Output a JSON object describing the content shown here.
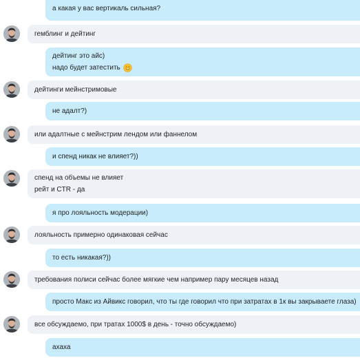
{
  "messages": [
    {
      "dir": "out",
      "lines": [
        "а какая у вас вертикаль сильная?"
      ]
    },
    {
      "dir": "in",
      "lines": [
        "гемблинг и дейтинг"
      ]
    },
    {
      "dir": "out",
      "lines": [
        "дейтинг это айс)",
        "надо будет затестить"
      ],
      "emoji": "smile-emoji"
    },
    {
      "dir": "in",
      "lines": [
        "дейтинги мейнстримовые"
      ]
    },
    {
      "dir": "out",
      "lines": [
        "не адалт?)"
      ]
    },
    {
      "dir": "in",
      "lines": [
        "или адалтные с мейнстрим лендом или фаннелом"
      ]
    },
    {
      "dir": "out",
      "lines": [
        "и спенд никак не влияет?))"
      ]
    },
    {
      "dir": "in",
      "lines": [
        "спенд на объемы не влияет",
        "рейт и CTR - да"
      ]
    },
    {
      "dir": "out",
      "lines": [
        "я про лояльность модерации)"
      ]
    },
    {
      "dir": "in",
      "lines": [
        "лояльность примерно одинаковая сейчас"
      ]
    },
    {
      "dir": "out",
      "lines": [
        "то есть никакая?))"
      ]
    },
    {
      "dir": "in",
      "lines": [
        "требования полиси сейчас более мягкие чем например пару месяцев назад"
      ]
    },
    {
      "dir": "out",
      "lines": [
        "просто Макс из Айвикс говорил, что ты где говорил что при затратах в 1к вы закрываете глаза)"
      ]
    },
    {
      "dir": "in",
      "lines": [
        "все обсуждаемо, при тратах 1000$ в день - точно обсуждаемо)"
      ]
    },
    {
      "dir": "out",
      "lines": [
        "ахаха"
      ]
    }
  ]
}
